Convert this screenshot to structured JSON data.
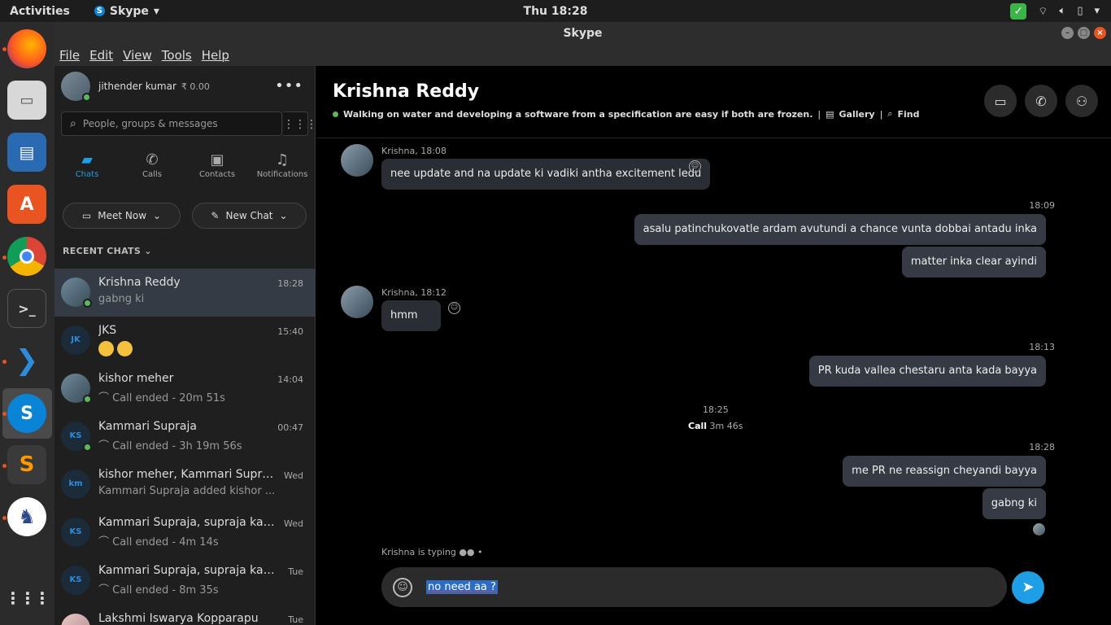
{
  "topbar": {
    "activities": "Activities",
    "app_name": "Skype",
    "clock": "Thu 18:28"
  },
  "window": {
    "title": "Skype"
  },
  "menu": [
    "File",
    "Edit",
    "View",
    "Tools",
    "Help"
  ],
  "profile": {
    "name": "jithender kumar",
    "credit": "₹ 0.00"
  },
  "search": {
    "placeholder": "People, groups & messages"
  },
  "nav_tabs": [
    {
      "label": "Chats",
      "icon": "chat-icon"
    },
    {
      "label": "Calls",
      "icon": "phone-icon"
    },
    {
      "label": "Contacts",
      "icon": "contacts-icon"
    },
    {
      "label": "Notifications",
      "icon": "bell-icon"
    }
  ],
  "actions": {
    "meet_now": "Meet Now",
    "new_chat": "New Chat"
  },
  "recent_header": "RECENT CHATS",
  "chats": [
    {
      "name": "Krishna Reddy",
      "preview": "gabng ki",
      "time": "18:28"
    },
    {
      "name": "JKS",
      "initials": "JK",
      "preview": "",
      "time": "15:40"
    },
    {
      "name": "kishor meher",
      "preview": "Call ended - 20m 51s",
      "time": "14:04"
    },
    {
      "name": "Kammari Supraja",
      "initials": "KS",
      "preview": "Call ended - 3h 19m 56s",
      "time": "00:47"
    },
    {
      "name": "kishor meher, Kammari Supraja",
      "initials": "km",
      "preview": "Kammari Supraja added kishor ...",
      "time": "Wed"
    },
    {
      "name": "Kammari Supraja, supraja kam...",
      "initials": "KS",
      "preview": "Call ended - 4m 14s",
      "time": "Wed"
    },
    {
      "name": "Kammari Supraja, supraja kamm...",
      "initials": "KS",
      "preview": "Call ended - 8m 35s",
      "time": "Tue"
    },
    {
      "name": "Lakshmi Iswarya Kopparapu",
      "preview": "",
      "time": "Tue"
    }
  ],
  "conversation": {
    "title": "Krishna Reddy",
    "mood": "Walking on water and developing a software from a specification are easy if both are frozen.",
    "gallery": "Gallery",
    "find": "Find",
    "messages": {
      "m1_meta": "Krishna, 18:08",
      "m1_text": "nee update and na update ki vadiki antha excitement ledu",
      "m2_time": "18:09",
      "m2_text": "asalu patinchukovatle ardam avutundi a chance vunta dobbai antadu inka",
      "m3_text": "matter inka clear ayindi",
      "m4_meta": "Krishna, 18:12",
      "m4_text": "hmm",
      "m5_time": "18:13",
      "m5_text": "PR kuda vallea chestaru anta kada bayya",
      "call_time": "18:25",
      "call_label": "Call",
      "call_duration": "3m 46s",
      "m6_time": "18:28",
      "m6_text": "me PR ne reassign cheyandi bayya",
      "m7_text": "gabng ki"
    },
    "typing": "Krishna is typing",
    "draft": "no need aa ?"
  },
  "colors": {
    "accent": "#1f9ee8",
    "online": "#5cb85c"
  }
}
